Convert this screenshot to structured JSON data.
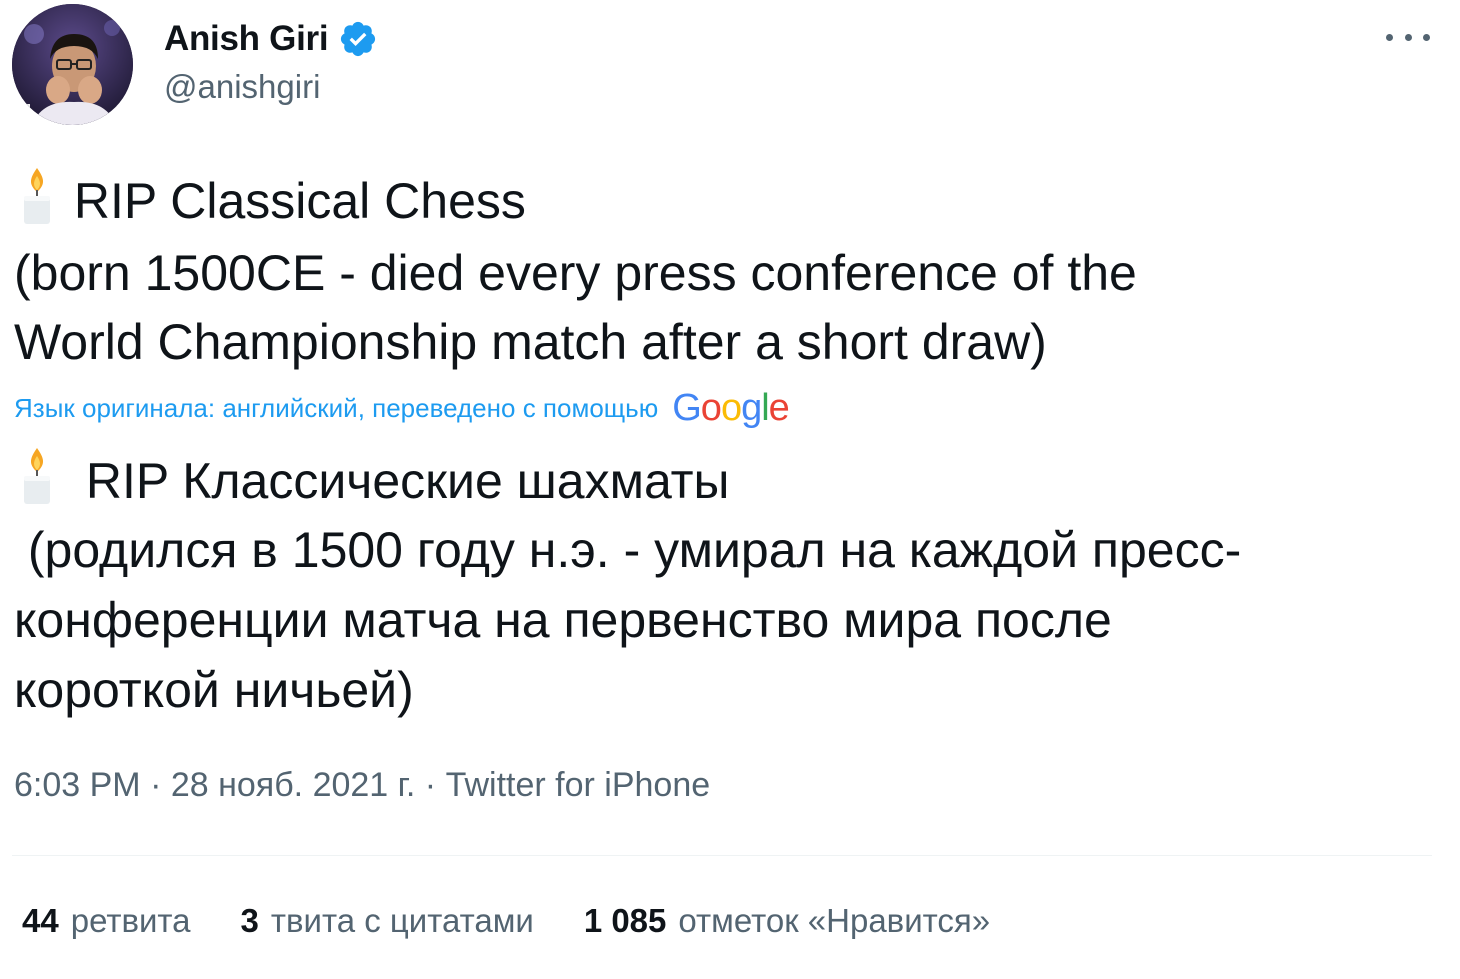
{
  "author": {
    "display_name": "Anish Giri",
    "handle": "@anishgiri",
    "verified": true,
    "avatar_icon": "profile-photo"
  },
  "tweet": {
    "original_lines": [
      "RIP Classical Chess",
      "(born 1500CE - died every press conference of the",
      "World Championship match after a short draw)"
    ],
    "translation_notice": "Язык оригинала: английский, переведено с помощью",
    "translation_provider": "Google",
    "translated_lines": [
      "RIP Классические шахматы",
      " (родился в 1500 году н.э. - умирал на каждой пресс-",
      "конференции матча на первенство мира после",
      "короткой ничьей)"
    ],
    "emoji": "candle"
  },
  "meta": {
    "time": "6:03 PM",
    "separator": " · ",
    "date": "28 нояб. 2021 г.",
    "source": "Twitter for iPhone"
  },
  "stats": {
    "retweets_count": "44",
    "retweets_label": "ретвита",
    "quotes_count": "3",
    "quotes_label": "твита с цитатами",
    "likes_count": "1 085",
    "likes_label": "отметок «Нравится»"
  },
  "colors": {
    "text": "#0f1419",
    "secondary": "#536471",
    "link": "#1d9bf0",
    "verified": "#1d9bf0",
    "divider": "#eff3f4",
    "google_blue": "#4285F4",
    "google_red": "#EA4335",
    "google_yellow": "#FBBC05",
    "google_green": "#34A853"
  }
}
